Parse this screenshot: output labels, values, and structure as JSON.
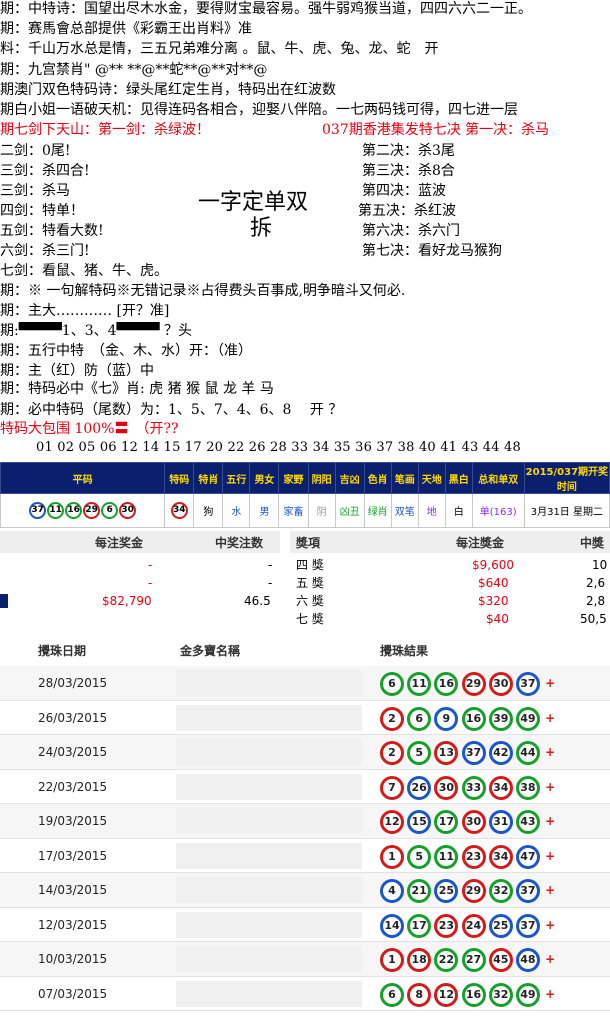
{
  "poem": {
    "lines": [
      "期：中特诗：国望出尽木水金，要得财宝最容易。强牛弱鸡猴当道，四四六六二一正。",
      "期：赛馬會总部提供《彩霸王出肖料》准",
      "料：千山万水总是情，三五兄弟难分离 。鼠、牛、虎、兔、龙、蛇　开",
      "期：九宫禁肖\" @** **@**蛇**@**对**@",
      "期澳门双色特码诗：绿头尾红定生肖，特码出在红波数",
      "期白小姐一语破天机：见得连码各相合，迎娶八伴陪。一七两码钱可得，四七进一层"
    ],
    "red_left": "期七剑下天山：第一剑：杀绿波！",
    "red_right": "037期香港集发特七决 第一决：杀马",
    "left_col": [
      "二剑：0尾!",
      "三剑：杀四合!",
      "三剑：杀马",
      "四剑：特单！",
      "五剑：特看大数!",
      "六剑：杀三门!",
      "七剑：看鼠、猪、牛、虎。"
    ],
    "right_col": [
      "第二决：杀3尾",
      "第三决：杀8合",
      "第四决：蓝波",
      "第五决：杀红波",
      "第六决：杀六门",
      "第七决：看好龙马猴狗"
    ],
    "center_title": "一字定单双",
    "center_title2": "拆",
    "lower": [
      "期：※ 一句解特码※无错记录※占得费头百事成,明争暗斗又何必.",
      "期：主大………… [开？准]",
      "期:▀▀▀▀1、3、4▀▀▀▀ ？头",
      "期：五行中特　（金、木、水）开：（准）",
      "期：主（红）防（蓝）中",
      "期：特码必中《七》肖: 虎 猪 猴 鼠 龙 羊 马",
      "期：必中特码（尾数）为：1、5、7、4、6、8　 开 ？"
    ],
    "bigpack": "特码大包围 100%〓　（开??",
    "numbers": "01 02 05 06 12 14 15 17 20 22 26 28 33 34 35 36 37 38 40 41 43 44 48"
  },
  "draw": {
    "headers": [
      "平码",
      "特码",
      "特肖",
      "五行",
      "男女",
      "家野",
      "阴阳",
      "吉凶",
      "色肖",
      "笔画",
      "天地",
      "黑白",
      "总和单双",
      "2015/037期开奖时间"
    ],
    "balls": [
      {
        "n": "37",
        "c": "blue"
      },
      {
        "n": "11",
        "c": "green"
      },
      {
        "n": "16",
        "c": "green"
      },
      {
        "n": "29",
        "c": "red"
      },
      {
        "n": "6",
        "c": "green"
      },
      {
        "n": "30",
        "c": "red"
      }
    ],
    "special": {
      "n": "34",
      "c": "red"
    },
    "cells": [
      "狗",
      "水",
      "男",
      "家畜",
      "阴",
      "凶丑",
      "绿肖",
      "双笔",
      "地",
      "白",
      "单(163)",
      "3月31日 星期二"
    ]
  },
  "prize": {
    "left_headers": [
      "每注奖金",
      "中奖注数"
    ],
    "left_rows": [
      {
        "amount": "-",
        "count": "-"
      },
      {
        "amount": "-",
        "count": "-"
      },
      {
        "amount": "$82,790",
        "count": "46.5"
      }
    ],
    "right_headers": [
      "獎項",
      "每注獎金",
      "中獎"
    ],
    "right_rows": [
      {
        "name": "四 獎",
        "amount": "$9,600",
        "count": "10"
      },
      {
        "name": "五 獎",
        "amount": "$640",
        "count": "2,6"
      },
      {
        "name": "六 獎",
        "amount": "$320",
        "count": "2,8"
      },
      {
        "name": "七 獎",
        "amount": "$40",
        "count": "50,5"
      }
    ]
  },
  "results": {
    "headers": [
      "攪珠日期",
      "金多寶名稱",
      "攪珠結果"
    ],
    "rows": [
      {
        "date": "28/03/2015",
        "balls": [
          {
            "n": "6",
            "c": "green"
          },
          {
            "n": "11",
            "c": "green"
          },
          {
            "n": "16",
            "c": "green"
          },
          {
            "n": "29",
            "c": "red"
          },
          {
            "n": "30",
            "c": "red"
          },
          {
            "n": "37",
            "c": "blue"
          }
        ]
      },
      {
        "date": "26/03/2015",
        "balls": [
          {
            "n": "2",
            "c": "red"
          },
          {
            "n": "6",
            "c": "green"
          },
          {
            "n": "9",
            "c": "blue"
          },
          {
            "n": "16",
            "c": "green"
          },
          {
            "n": "39",
            "c": "green"
          },
          {
            "n": "49",
            "c": "green"
          }
        ]
      },
      {
        "date": "24/03/2015",
        "balls": [
          {
            "n": "2",
            "c": "red"
          },
          {
            "n": "5",
            "c": "green"
          },
          {
            "n": "13",
            "c": "red"
          },
          {
            "n": "37",
            "c": "blue"
          },
          {
            "n": "42",
            "c": "blue"
          },
          {
            "n": "44",
            "c": "green"
          }
        ]
      },
      {
        "date": "22/03/2015",
        "balls": [
          {
            "n": "7",
            "c": "red"
          },
          {
            "n": "26",
            "c": "blue"
          },
          {
            "n": "30",
            "c": "red"
          },
          {
            "n": "33",
            "c": "green"
          },
          {
            "n": "34",
            "c": "red"
          },
          {
            "n": "38",
            "c": "green"
          }
        ]
      },
      {
        "date": "19/03/2015",
        "balls": [
          {
            "n": "12",
            "c": "red"
          },
          {
            "n": "15",
            "c": "blue"
          },
          {
            "n": "17",
            "c": "green"
          },
          {
            "n": "30",
            "c": "red"
          },
          {
            "n": "31",
            "c": "blue"
          },
          {
            "n": "43",
            "c": "green"
          }
        ]
      },
      {
        "date": "17/03/2015",
        "balls": [
          {
            "n": "1",
            "c": "red"
          },
          {
            "n": "5",
            "c": "green"
          },
          {
            "n": "11",
            "c": "green"
          },
          {
            "n": "23",
            "c": "red"
          },
          {
            "n": "34",
            "c": "red"
          },
          {
            "n": "47",
            "c": "blue"
          }
        ]
      },
      {
        "date": "14/03/2015",
        "balls": [
          {
            "n": "4",
            "c": "blue"
          },
          {
            "n": "21",
            "c": "green"
          },
          {
            "n": "25",
            "c": "blue"
          },
          {
            "n": "29",
            "c": "red"
          },
          {
            "n": "32",
            "c": "green"
          },
          {
            "n": "37",
            "c": "blue"
          }
        ]
      },
      {
        "date": "12/03/2015",
        "balls": [
          {
            "n": "14",
            "c": "blue"
          },
          {
            "n": "17",
            "c": "green"
          },
          {
            "n": "23",
            "c": "red"
          },
          {
            "n": "24",
            "c": "red"
          },
          {
            "n": "25",
            "c": "blue"
          },
          {
            "n": "37",
            "c": "blue"
          }
        ]
      },
      {
        "date": "10/03/2015",
        "balls": [
          {
            "n": "1",
            "c": "red"
          },
          {
            "n": "18",
            "c": "red"
          },
          {
            "n": "22",
            "c": "green"
          },
          {
            "n": "27",
            "c": "green"
          },
          {
            "n": "45",
            "c": "red"
          },
          {
            "n": "48",
            "c": "blue"
          }
        ]
      },
      {
        "date": "07/03/2015",
        "balls": [
          {
            "n": "6",
            "c": "green"
          },
          {
            "n": "8",
            "c": "red"
          },
          {
            "n": "12",
            "c": "red"
          },
          {
            "n": "16",
            "c": "green"
          },
          {
            "n": "32",
            "c": "green"
          },
          {
            "n": "49",
            "c": "green"
          }
        ]
      }
    ],
    "plus": "+"
  },
  "colors": {
    "red": "#d21b1b",
    "blue": "#1b55c8",
    "green": "#14a02a",
    "header_bg": "#0a1f6e",
    "header_text": "#ffd800"
  }
}
